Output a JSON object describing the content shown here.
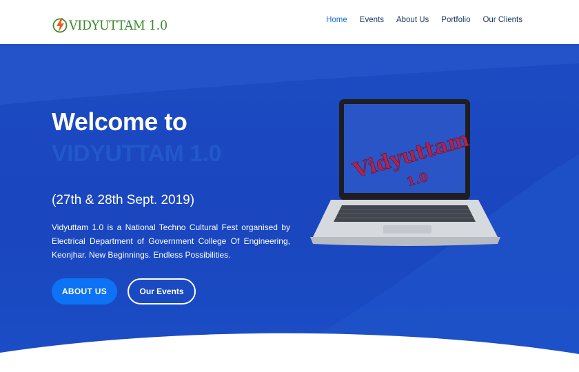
{
  "brand": {
    "name": "VIDYUTTAM 1.0",
    "colors": {
      "logo_text": "#3a8a2a",
      "logo_bolt": "#f05a1a"
    }
  },
  "nav": {
    "items": [
      {
        "label": "Home",
        "active": true
      },
      {
        "label": "Events",
        "active": false
      },
      {
        "label": "About Us",
        "active": false
      },
      {
        "label": "Portfolio",
        "active": false
      },
      {
        "label": "Our Clients",
        "active": false
      }
    ]
  },
  "hero": {
    "title": "Welcome to",
    "subtitle": "VIDYUTTAM 1.0",
    "dates": "(27th & 28th Sept. 2019)",
    "description": "Vidyuttam 1.0 is a National Techno Cultural Fest organised by Electrical Department of Government College Of Engineering, Keonjhar. New Beginnings. Endless Possibilities.",
    "buttons": {
      "about": "ABOUT US",
      "events": "Our Events"
    },
    "colors": {
      "background": "#1c4bc2",
      "primary_button": "#0d73f4",
      "subtitle": "#2258c9"
    }
  },
  "laptop_screen": {
    "line1": "Vidyuttam",
    "line2": "1.0",
    "icon": "laptop-icon"
  }
}
